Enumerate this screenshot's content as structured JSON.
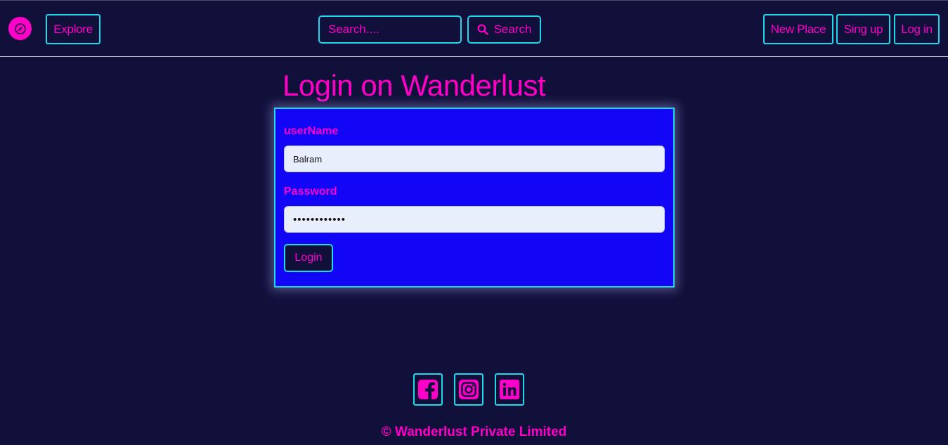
{
  "navbar": {
    "logo_icon": "compass-icon",
    "explore_label": "Explore",
    "search_placeholder": "Search....",
    "search_button_label": "Search",
    "search_icon": "search-icon",
    "new_place_label": "New Place",
    "signup_label": "Sing up",
    "login_label": "Log in"
  },
  "main": {
    "title": "Login on Wanderlust",
    "form": {
      "username_label": "userName",
      "username_value": "Balram",
      "password_label": "Password",
      "password_value": "••••••••••••",
      "submit_label": "Login"
    }
  },
  "footer": {
    "social_icons": [
      "facebook-icon",
      "instagram-icon",
      "linkedin-icon"
    ],
    "copyright": "© Wanderlust Private Limited"
  },
  "colors": {
    "background": "#11103b",
    "accent": "#ff00c8",
    "border": "#1fd8e8",
    "card": "#1206f7"
  }
}
